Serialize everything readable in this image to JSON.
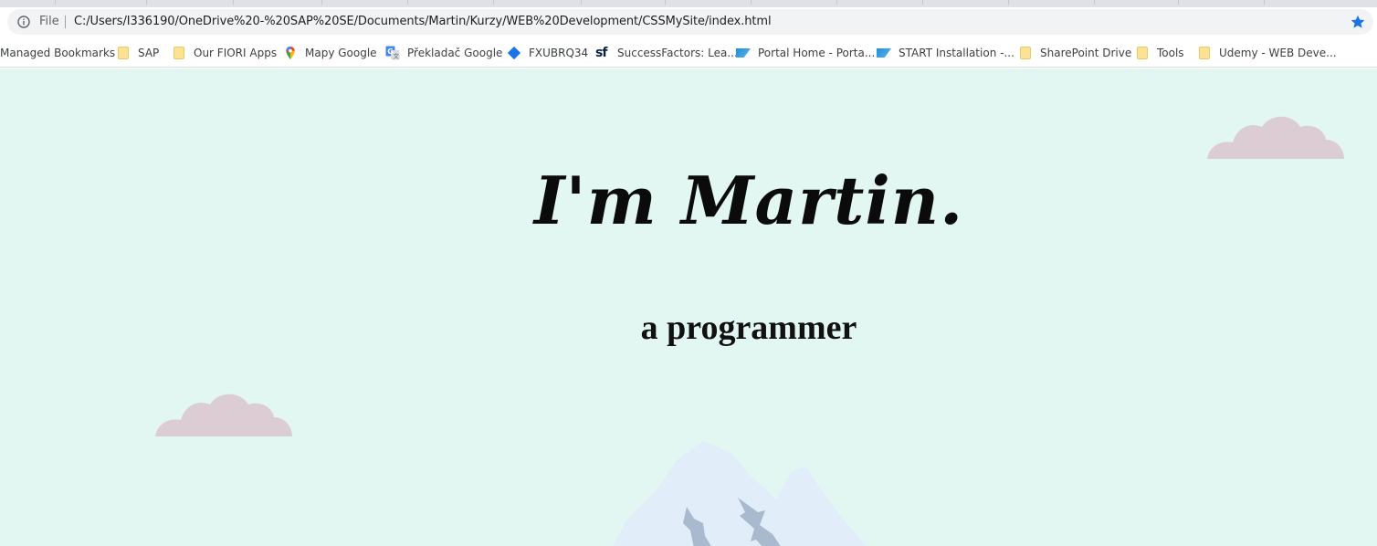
{
  "browser": {
    "scheme_label": "File",
    "url": "C:/Users/I336190/OneDrive%20-%20SAP%20SE/Documents/Martin/Kurzy/WEB%20Development/CSSMySite/index.html",
    "accent_color": "#1a73e8"
  },
  "bookmarks": {
    "items": [
      {
        "label": "Managed Bookmarks",
        "icon": "none"
      },
      {
        "label": "SAP",
        "icon": "folder-icon"
      },
      {
        "label": "Our FIORI Apps",
        "icon": "folder-icon"
      },
      {
        "label": "Mapy Google",
        "icon": "maps-pin-icon"
      },
      {
        "label": "Překladač Google",
        "icon": "translate-icon"
      },
      {
        "label": "FXUBRQ34",
        "icon": "diamond-icon"
      },
      {
        "label": "SuccessFactors: Lea...",
        "icon": "sf-icon"
      },
      {
        "label": "Portal Home - Porta...",
        "icon": "sap-logo-icon"
      },
      {
        "label": "START Installation -...",
        "icon": "sap-logo-icon"
      },
      {
        "label": "SharePoint Drive",
        "icon": "folder-icon"
      },
      {
        "label": "Tools",
        "icon": "folder-icon"
      },
      {
        "label": "Udemy - WEB Deve...",
        "icon": "folder-icon"
      }
    ]
  },
  "page": {
    "title": "I'm Martin.",
    "subtitle": "a programmer",
    "background_color": "#e3f7f2",
    "cloud_color": "#dbcdd3",
    "mountain_color": "#e1edf8",
    "mountain_shade_color": "#a9bace"
  }
}
